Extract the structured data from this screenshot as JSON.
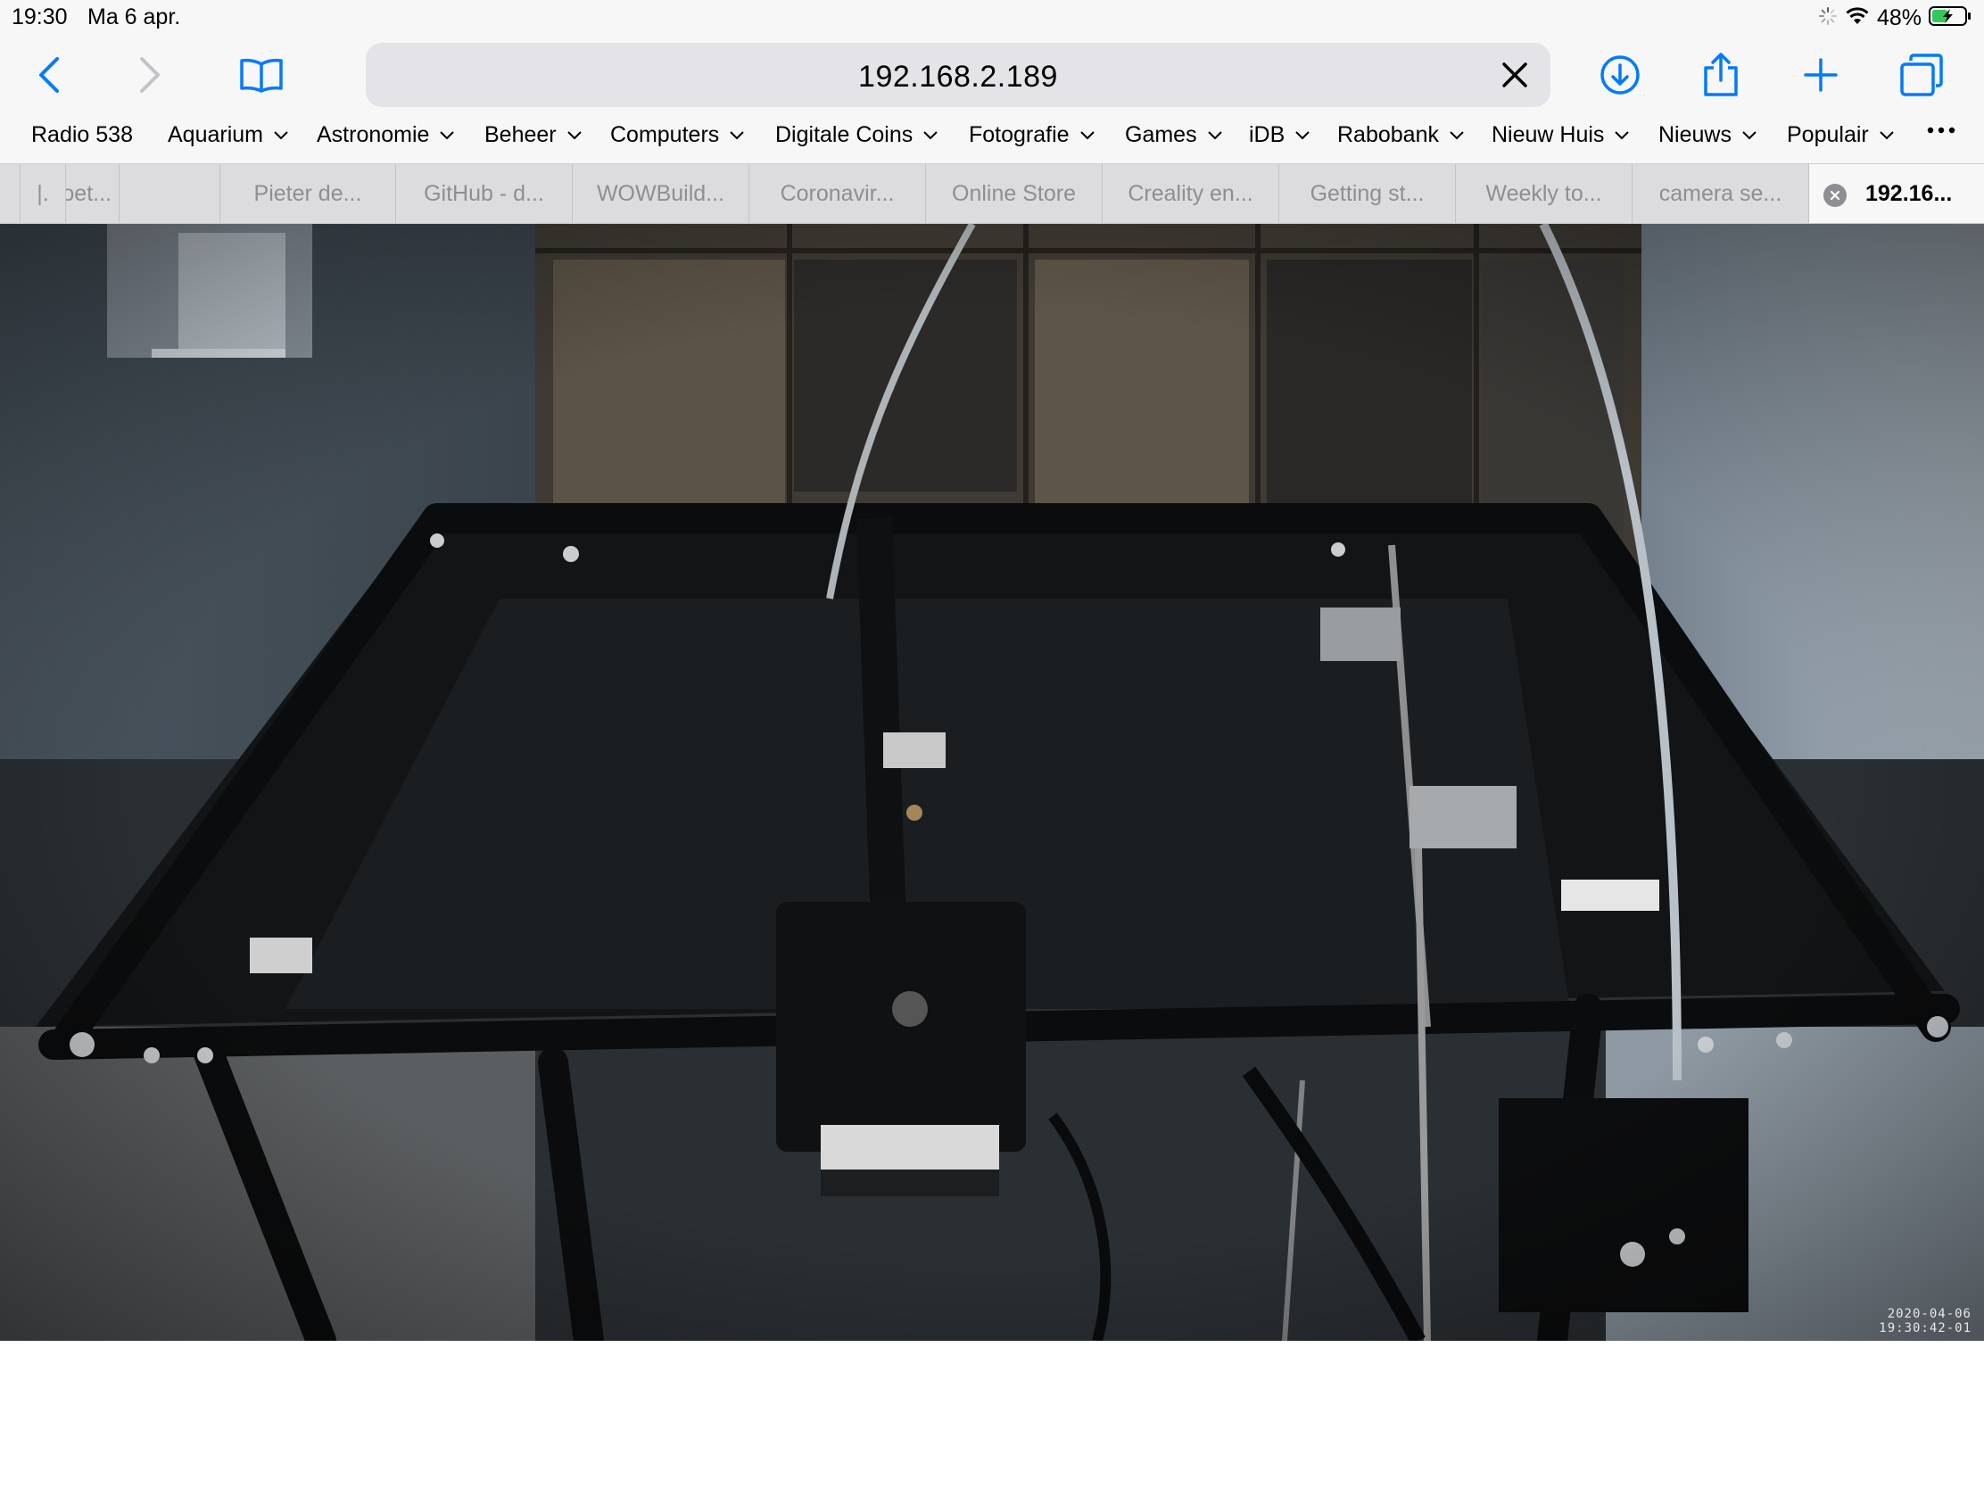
{
  "status_bar": {
    "time": "19:30",
    "date": "Ma 6 apr.",
    "battery_percent": "48%",
    "battery_level": 0.48,
    "icons": [
      "activity-spinner-icon",
      "wifi-icon",
      "battery-charging-icon"
    ]
  },
  "toolbar": {
    "url": "192.168.2.189",
    "buttons": [
      "back-icon",
      "forward-icon",
      "bookmarks-book-icon",
      "download-icon",
      "share-icon",
      "new-tab-plus-icon",
      "tabs-overview-icon"
    ],
    "accent_color": "#007aff"
  },
  "bookmarks": [
    {
      "label": "Radio 538",
      "folder": false
    },
    {
      "label": "Aquarium",
      "folder": true
    },
    {
      "label": "Astronomie",
      "folder": true
    },
    {
      "label": "Beheer",
      "folder": true
    },
    {
      "label": "Computers",
      "folder": true
    },
    {
      "label": "Digitale Coins",
      "folder": true
    },
    {
      "label": "Fotografie",
      "folder": true
    },
    {
      "label": "Games",
      "folder": true
    },
    {
      "label": "iDB",
      "folder": true
    },
    {
      "label": "Rabobank",
      "folder": true
    },
    {
      "label": "Nieuw Huis",
      "folder": true
    },
    {
      "label": "Nieuws",
      "folder": true
    },
    {
      "label": "Populair",
      "folder": true
    }
  ],
  "tabs": [
    {
      "label": "|."
    },
    {
      "label": "voet..."
    },
    {
      "label": "Pieter de..."
    },
    {
      "label": "GitHub - d..."
    },
    {
      "label": "WOWBuild..."
    },
    {
      "label": "Coronavir..."
    },
    {
      "label": "Online Store"
    },
    {
      "label": "Creality en..."
    },
    {
      "label": "Getting st..."
    },
    {
      "label": "Weekly to..."
    },
    {
      "label": "camera se..."
    },
    {
      "label": "192.16...",
      "active": true
    }
  ],
  "stream": {
    "timestamp_date": "2020-04-06",
    "timestamp_time": "19:30:42-01"
  }
}
